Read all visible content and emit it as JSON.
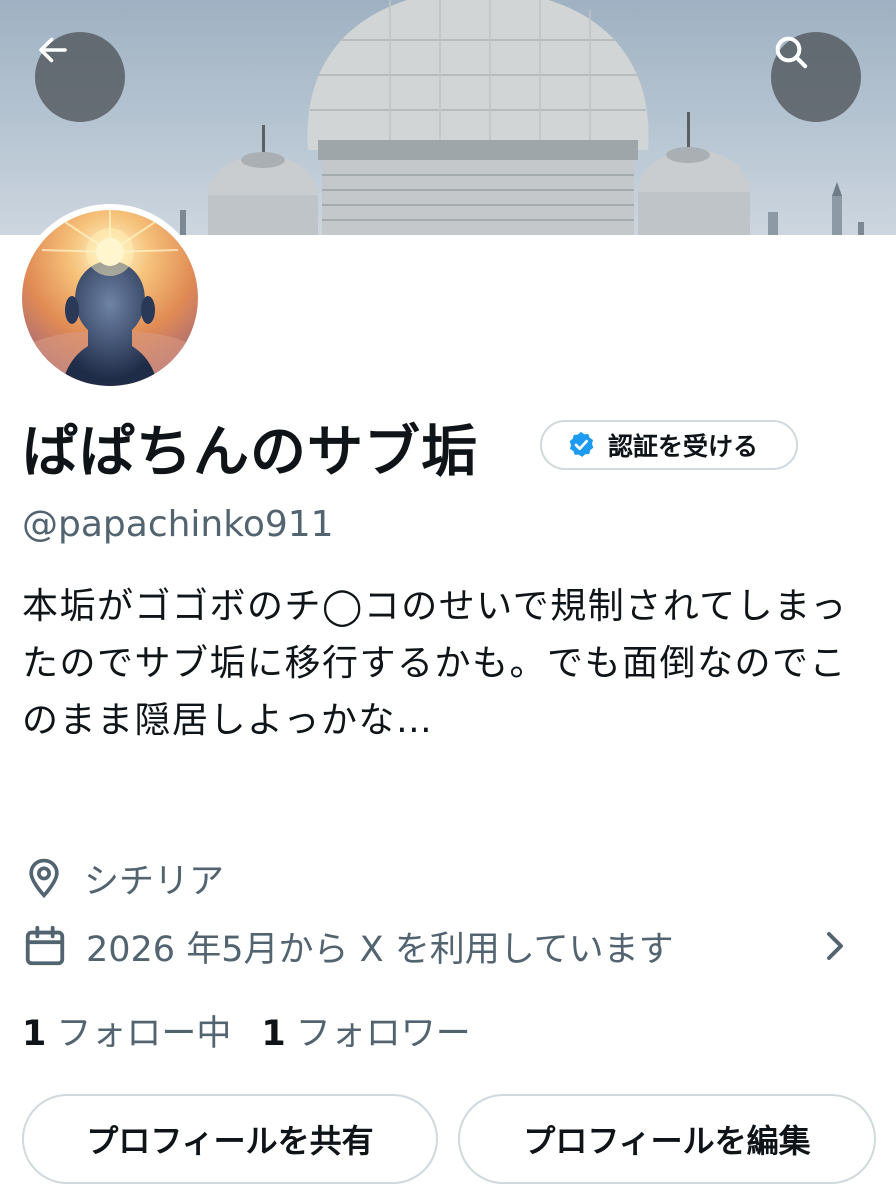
{
  "profile": {
    "display_name": "ぱぱちんのサブ垢",
    "verify_label": "認証を受ける",
    "handle": "@papachinko911",
    "bio": "本垢がゴゴボのチ◯コのせいで規制されてしまったのでサブ垢に移行するかも。でも面倒なのでこのまま隠居しよっかな…",
    "location": "シチリア",
    "joined": "2026 年5月から X を利用しています",
    "following_count": "1",
    "following_label": "フォロー中",
    "followers_count": "1",
    "followers_label": "フォロワー"
  },
  "buttons": {
    "share_profile": "プロフィールを共有",
    "edit_profile": "プロフィールを編集"
  },
  "icons": {
    "back": "arrow-left-icon",
    "search": "search-icon",
    "verified": "verified-badge-icon",
    "location": "location-pin-icon",
    "calendar": "calendar-icon",
    "chevron": "chevron-right-icon"
  },
  "colors": {
    "text": "#0f1419",
    "secondary_text": "#536471",
    "border": "#cfd9de",
    "verified_blue": "#1d9bf0"
  }
}
